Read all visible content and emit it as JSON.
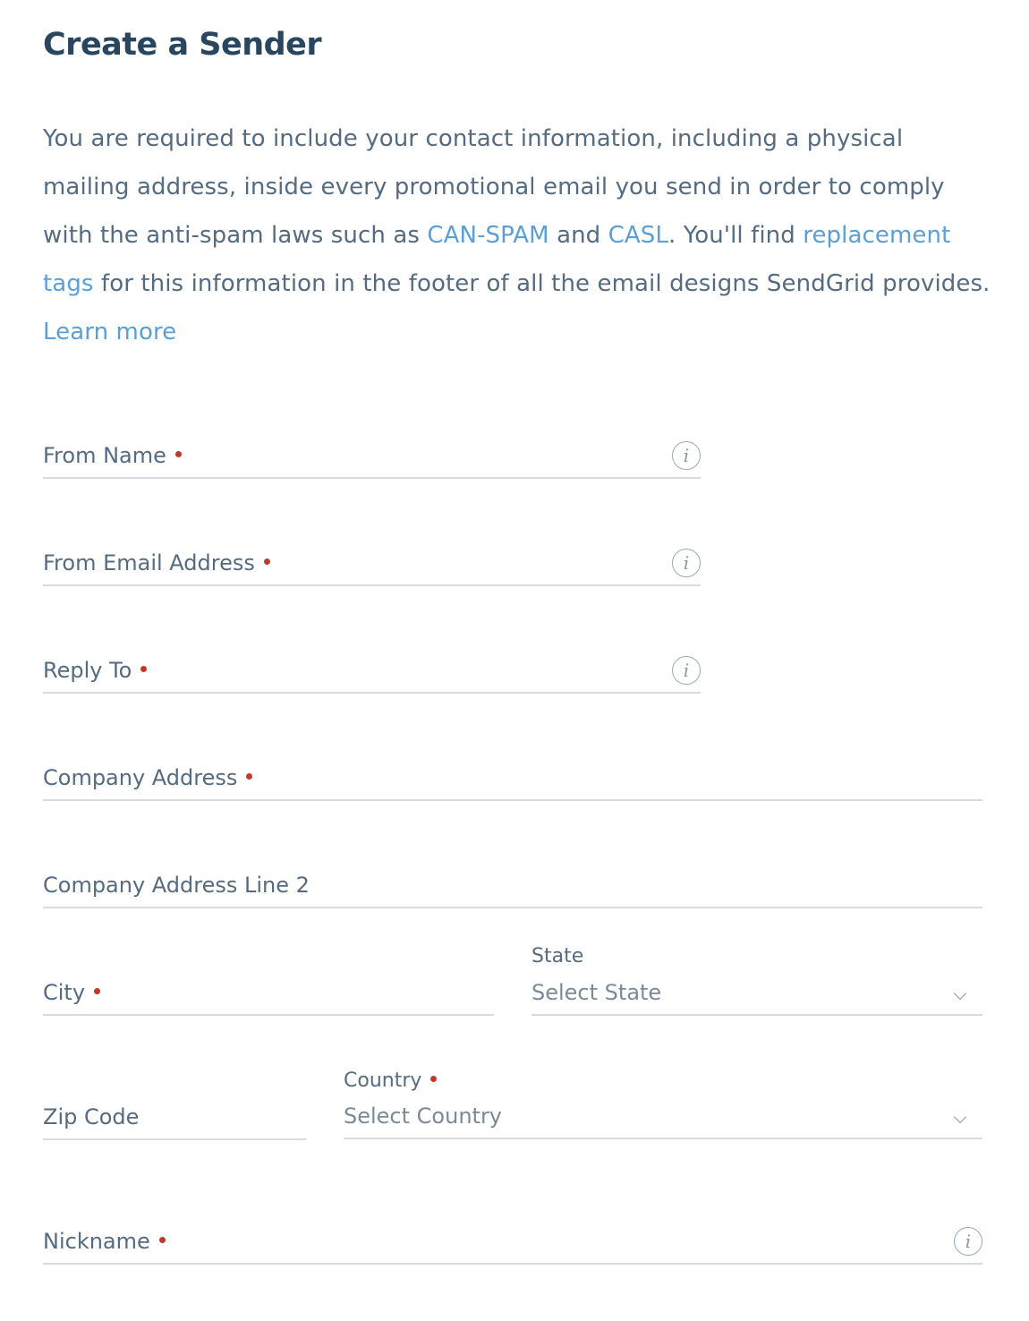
{
  "title": "Create a Sender",
  "intro": {
    "part1": "You are required to include your contact information, including a physical mailing address, inside every promotional email you send in order to comply with the anti-spam laws such as ",
    "link_canspam": "CAN-SPAM",
    "and": " and ",
    "link_casl": "CASL",
    "part2": ". You'll find ",
    "link_replacement": "replacement tags",
    "part3": " for this information in the footer of all the email designs SendGrid provides. ",
    "link_learn": "Learn more"
  },
  "fields": {
    "from_name": "From Name",
    "from_email": "From Email Address",
    "reply_to": "Reply To",
    "company_address": "Company Address",
    "company_address_2": "Company Address Line 2",
    "city": "City",
    "state_label": "State",
    "state_value": "Select State",
    "zip": "Zip Code",
    "country_label": "Country",
    "country_value": "Select Country",
    "nickname": "Nickname"
  },
  "icons": {
    "info": "info-icon",
    "chevron": "chevron-down-icon"
  },
  "colors": {
    "title": "#294661",
    "text": "#546b81",
    "link": "#5a9fd8",
    "required": "#c0392b",
    "border": "#d6dce2"
  }
}
